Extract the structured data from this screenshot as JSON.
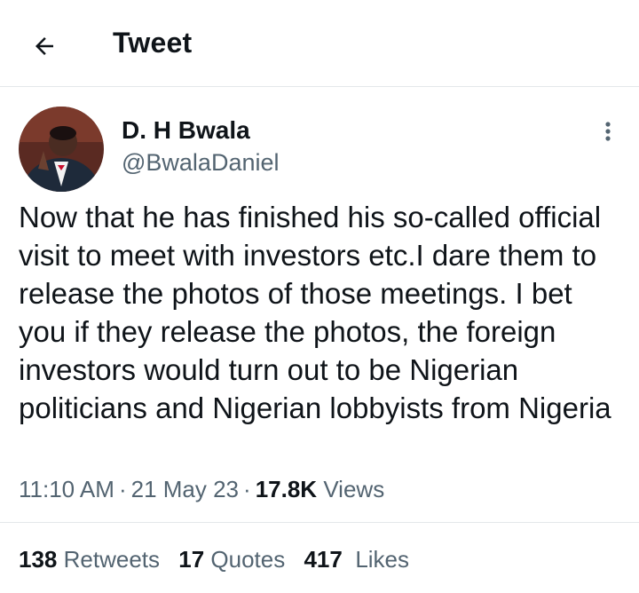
{
  "header": {
    "back_icon": "arrow-left-icon",
    "title": "Tweet"
  },
  "author": {
    "display_name": "D. H Bwala",
    "handle": "@BwalaDaniel",
    "avatar_icon": "avatar-photo",
    "more_icon": "more-vertical-icon"
  },
  "tweet": {
    "text": "Now that he has finished his so-called official visit to meet with investors etc.I dare them to release the photos of those meetings. I bet you if they release the photos, the foreign investors would turn out to be Nigerian politicians and Nigerian lobbyists from Nigeria"
  },
  "meta": {
    "time": "11:10 AM",
    "date": "21 May 23",
    "separator": "·",
    "views_count": "17.8K",
    "views_label": "Views"
  },
  "stats": {
    "retweets_count": "138",
    "retweets_label": "Retweets",
    "quotes_count": "17",
    "quotes_label": "Quotes",
    "likes_count": "417",
    "likes_label": "Likes"
  },
  "colors": {
    "text_primary": "#0f1419",
    "text_secondary": "#536471",
    "divider": "#e4e7ea"
  }
}
